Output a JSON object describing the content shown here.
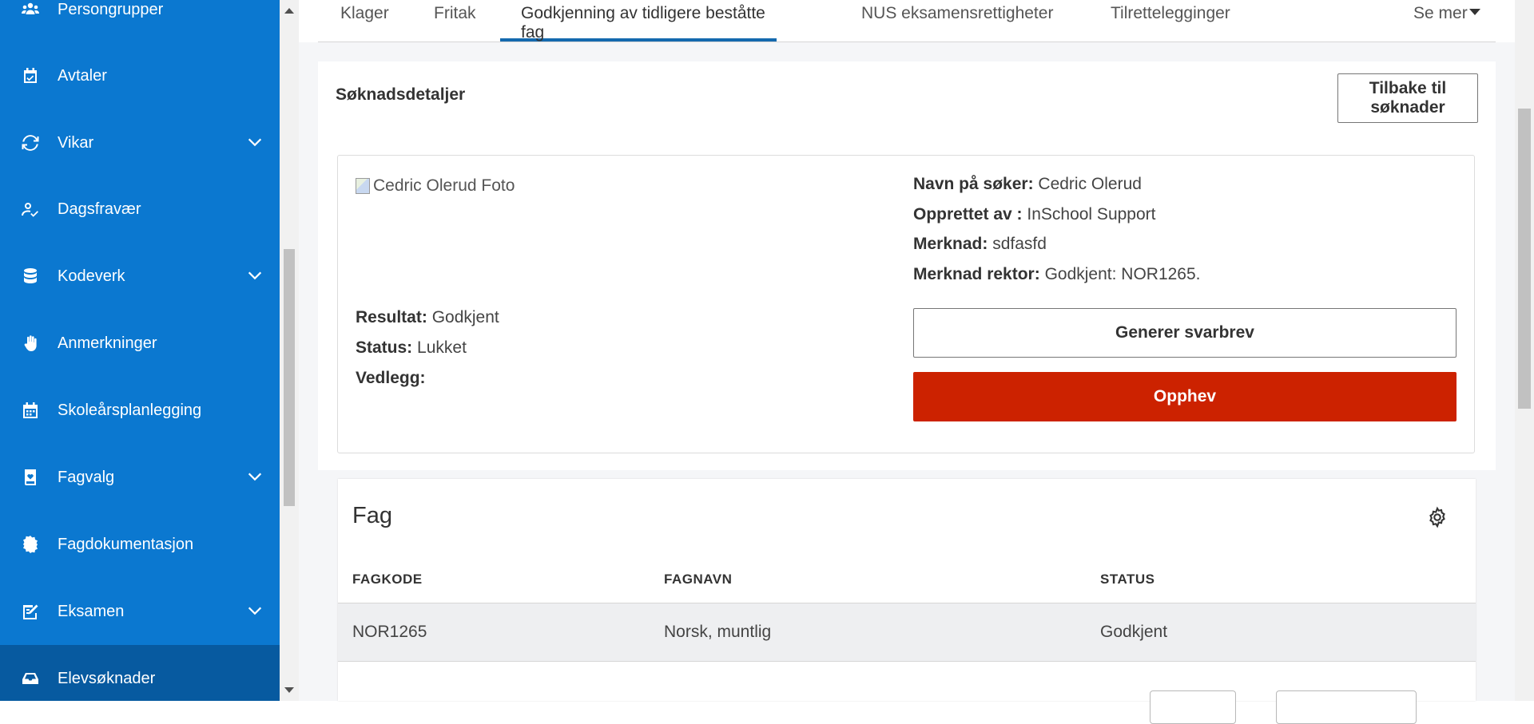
{
  "sidebar": {
    "items": [
      {
        "label": "Persongrupper",
        "icon": "people-group-icon",
        "has_chevron": false
      },
      {
        "label": "Avtaler",
        "icon": "calendar-check-icon",
        "has_chevron": false
      },
      {
        "label": "Vikar",
        "icon": "sync-icon",
        "has_chevron": true
      },
      {
        "label": "Dagsfravær",
        "icon": "user-check-icon",
        "has_chevron": false
      },
      {
        "label": "Kodeverk",
        "icon": "database-icon",
        "has_chevron": true
      },
      {
        "label": "Anmerkninger",
        "icon": "hand-icon",
        "has_chevron": false
      },
      {
        "label": "Skoleårsplanlegging",
        "icon": "calendar-icon",
        "has_chevron": false
      },
      {
        "label": "Fagvalg",
        "icon": "book-heart-icon",
        "has_chevron": true
      },
      {
        "label": "Fagdokumentasjon",
        "icon": "badge-icon",
        "has_chevron": false
      },
      {
        "label": "Eksamen",
        "icon": "exam-edit-icon",
        "has_chevron": true
      },
      {
        "label": "Elevsøknader",
        "icon": "inbox-icon",
        "has_chevron": false,
        "active": true
      }
    ]
  },
  "tabs": {
    "items": [
      "Klager",
      "Fritak",
      "Godkjenning av tidligere beståtte fag",
      "NUS eksamensrettigheter",
      "Tilrettelegginger"
    ],
    "active": "Godkjenning av tidligere beståtte fag",
    "more_label": "Se mer"
  },
  "details": {
    "title": "Søknadsdetaljer",
    "back_button": "Tilbake til søknader",
    "photo_alt": "Cedric Olerud Foto",
    "left": [
      {
        "label": "Resultat:",
        "value": "Godkjent"
      },
      {
        "label": "Status:",
        "value": "Lukket"
      },
      {
        "label": "Vedlegg:",
        "value": ""
      }
    ],
    "right": [
      {
        "label": "Navn på søker:",
        "value": "Cedric Olerud"
      },
      {
        "label": "Opprettet av :",
        "value": "InSchool Support"
      },
      {
        "label": "Merknad:",
        "value": "sdfasfd"
      },
      {
        "label": "Merknad rektor:",
        "value": "Godkjent: NOR1265."
      }
    ],
    "generate_button": "Generer svarbrev",
    "revoke_button": "Opphev",
    "colors": {
      "revoke": "#cc2200",
      "sidebar": "#0b78d0",
      "sidebar_active": "#075aa0",
      "tab_underline": "#1469ae"
    }
  },
  "fag": {
    "title": "Fag",
    "columns": [
      "FAGKODE",
      "FAGNAVN",
      "STATUS"
    ],
    "rows": [
      {
        "fagkode": "NOR1265",
        "fagnavn": "Norsk, muntlig",
        "status": "Godkjent"
      }
    ]
  }
}
